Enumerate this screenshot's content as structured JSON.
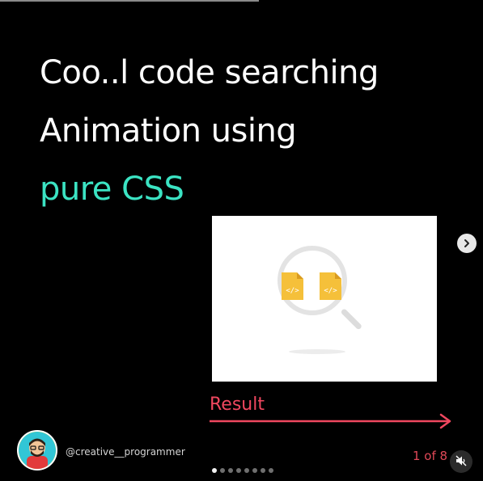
{
  "headline": {
    "line1": "Coo..l code searching",
    "line2": "Animation using",
    "line3": "pure CSS"
  },
  "preview": {
    "icons": [
      "magnifier-icon",
      "code-file-icon",
      "code-file-icon"
    ],
    "file_icon_color": "#f5c03a"
  },
  "result": {
    "label": "Result"
  },
  "account": {
    "username": "@creative__programmer"
  },
  "pagination": {
    "counter": "1 of 8",
    "current": 1,
    "total": 8
  },
  "colors": {
    "background": "#000000",
    "accent_teal": "#3be3c3",
    "accent_red": "#f0475f",
    "white": "#ffffff"
  },
  "controls": {
    "next_icon": "chevron-right-icon",
    "mute_icon": "speaker-muted-icon"
  }
}
